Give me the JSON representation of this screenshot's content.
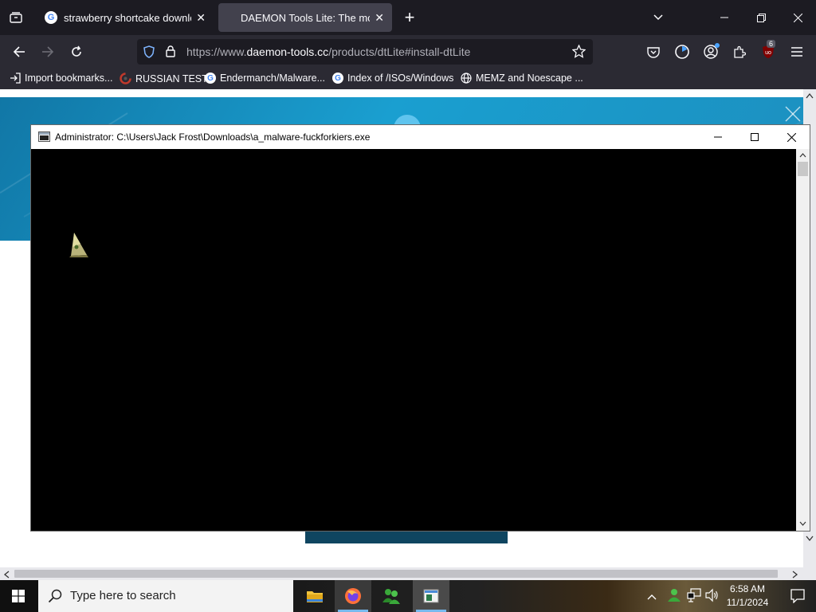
{
  "browser": {
    "tabs": [
      {
        "title": "strawberry shortcake download",
        "active": false
      },
      {
        "title": "DAEMON Tools Lite: The most popular",
        "active": true
      }
    ],
    "url": {
      "prefix": "https://www.",
      "host": "daemon-tools.cc",
      "path": "/products/dtLite#install-dtLite"
    },
    "extension_badge": "6",
    "bookmarks": [
      {
        "label": "Import bookmarks...",
        "icon": "import-icon"
      },
      {
        "label": "RUSSIAN TEST",
        "icon": "bookmark-favicon"
      },
      {
        "label": "Endermanch/Malware...",
        "icon": "google-icon"
      },
      {
        "label": "Index of /ISOs/Windows",
        "icon": "google-icon"
      },
      {
        "label": "MEMZ and Noescape ...",
        "icon": "globe-icon"
      }
    ]
  },
  "console_window": {
    "title": "Administrator:  C:\\Users\\Jack Frost\\Downloads\\a_malware-fuckforkiers.exe"
  },
  "taskbar": {
    "search_placeholder": "Type here to search",
    "time": "6:58 AM",
    "date": "11/1/2024"
  },
  "colors": {
    "browser_dark": "#1c1b22",
    "toolbar": "#2b2a33",
    "hero_blue": "#1a9fd0",
    "accent_shield": "#7fb5ff"
  }
}
